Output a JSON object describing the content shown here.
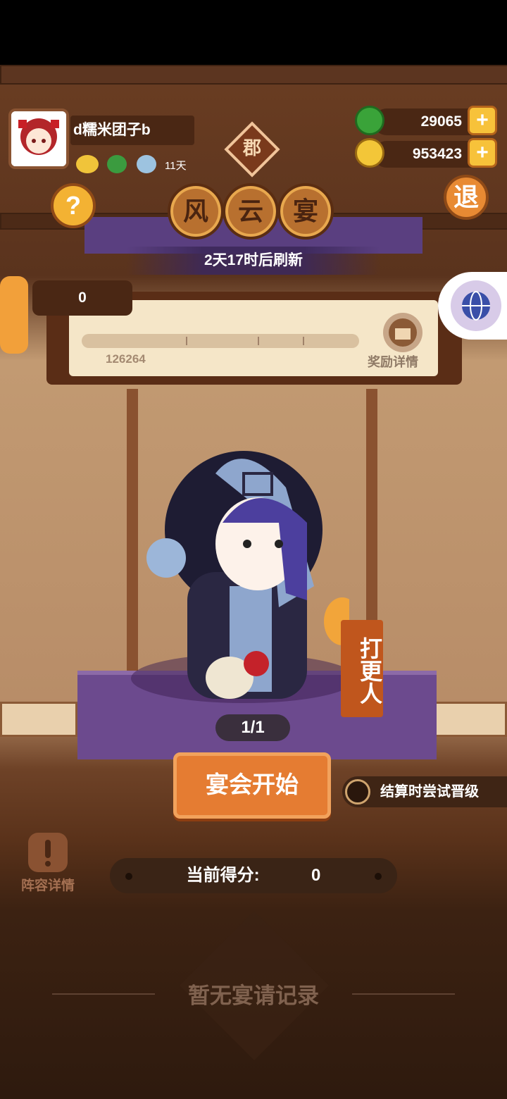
{
  "player": {
    "name": "d糯米团子b",
    "status_days": "11天"
  },
  "resources": {
    "jade": "29065",
    "coins": "953423"
  },
  "region_badge": "郡",
  "title_chars": [
    "风",
    "云",
    "宴"
  ],
  "buttons": {
    "help": "?",
    "exit": "退",
    "start": "宴会开始",
    "plus": "+"
  },
  "refresh_text": "2天17时后刷新",
  "score_tab": "0",
  "progress": {
    "milestone": "126264",
    "reward_label": "奖励详情"
  },
  "character": {
    "name": "打更人",
    "count": "1/1"
  },
  "promote_option": "结算时尝试晋级",
  "lineup_label": "阵容详情",
  "current_score": {
    "label": "当前得分:",
    "value": "0"
  },
  "empty_records": "暂无宴请记录",
  "icons": {
    "help": "question-icon",
    "exit": "exit-icon",
    "globe": "globe-icon",
    "reward": "gift-box-icon",
    "jade": "jade-coin-icon",
    "coin": "gold-coin-icon"
  }
}
